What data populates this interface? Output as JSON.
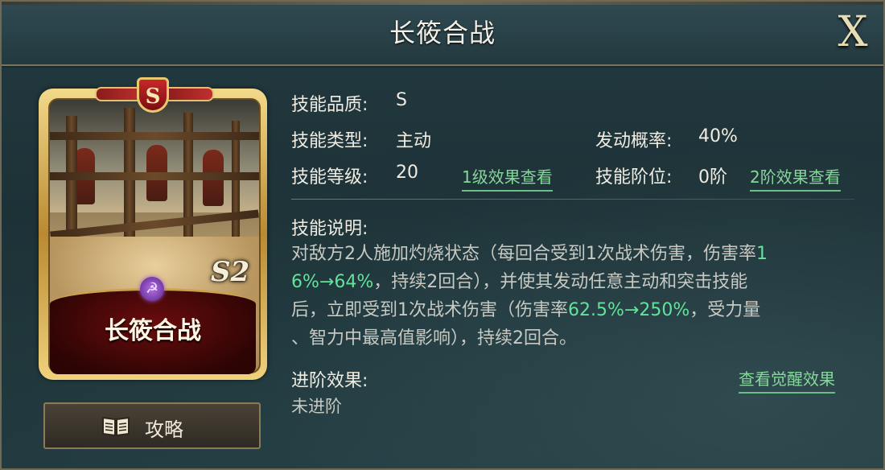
{
  "header": {
    "title": "长筱合战",
    "close_glyph": "X"
  },
  "card": {
    "rank_badge": "S",
    "season": "S2",
    "name": "长筱合战",
    "emblem_icon": "hammer-sickle-icon"
  },
  "guide_button": {
    "label": "攻略",
    "icon": "book-icon"
  },
  "info": {
    "quality_label": "技能品质:",
    "quality_value": "S",
    "type_label": "技能类型:",
    "type_value": "主动",
    "rate_label": "发动概率:",
    "rate_value": "40%",
    "level_label": "技能等级:",
    "level_value": "20",
    "level_link": "1级效果查看",
    "tier_label": "技能阶位:",
    "tier_value": "0阶",
    "tier_link": "2阶效果查看"
  },
  "description": {
    "heading": "技能说明:",
    "line1_a": "对敌方2人施加灼烧状态（每回合受到1次战术伤害，伤害率",
    "line1_b": "1",
    "line2_a": "6%→64%",
    "line2_b": "，持续2回合），并使其发动任意主动和突击技能",
    "line3_a": "后，立即受到1次战术伤害（伤害率",
    "line3_b": "62.5%→250%",
    "line3_c": "，受力量",
    "line4": "、智力中最高值影响），持续2回合。"
  },
  "advance": {
    "heading": "进阶效果:",
    "value": "未进阶",
    "link": "查看觉醒效果"
  },
  "colors": {
    "accent_green": "#63e29a",
    "link_green": "#86d79b",
    "gold": "#e6dcb6",
    "badge_red": "#c8282a"
  }
}
